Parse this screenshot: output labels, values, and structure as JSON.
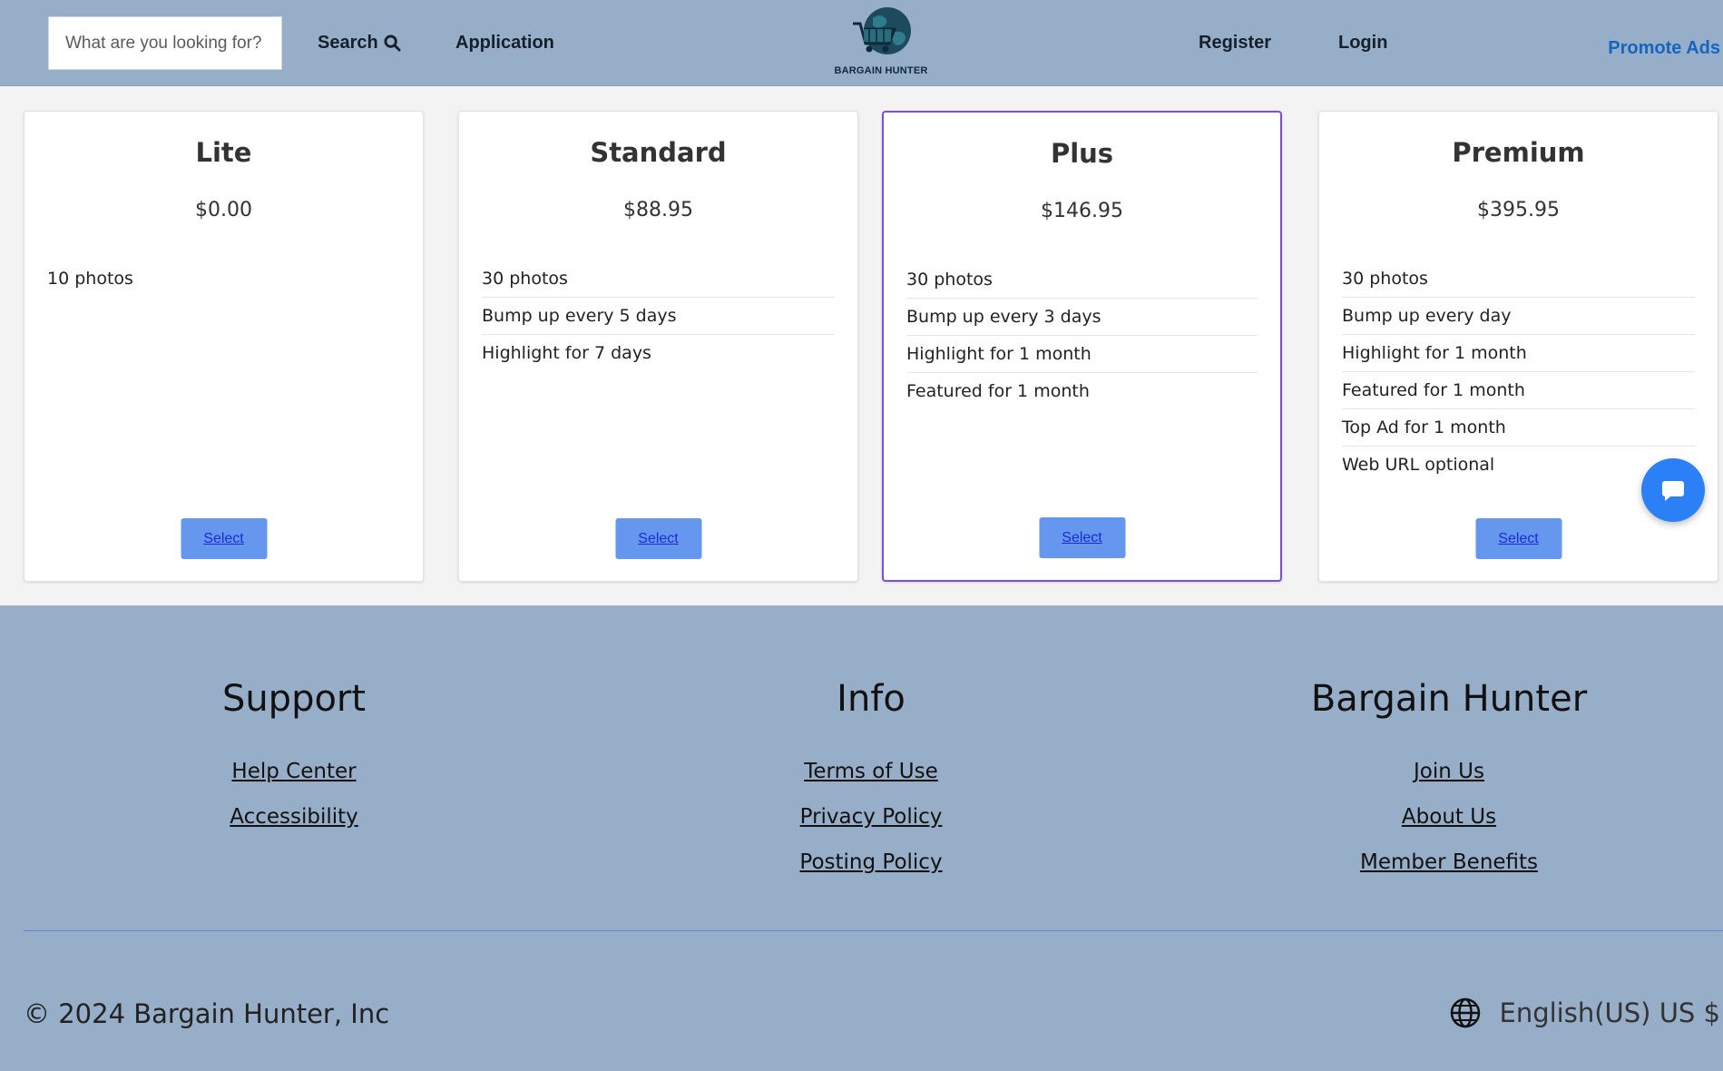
{
  "header": {
    "search_placeholder": "What are you looking for?",
    "search_label": "Search",
    "application_label": "Application",
    "logo_text": "BARGAIN HUNTER",
    "register_label": "Register",
    "login_label": "Login",
    "promote_label": "Promote Ads"
  },
  "plans": [
    {
      "name": "Lite",
      "price": "$0.00",
      "features": [
        "10 photos"
      ],
      "select_label": "Select"
    },
    {
      "name": "Standard",
      "price": "$88.95",
      "features": [
        "30 photos",
        "Bump up every 5 days",
        "Highlight for 7 days"
      ],
      "select_label": "Select"
    },
    {
      "name": "Plus",
      "price": "$146.95",
      "features": [
        "30 photos",
        "Bump up every 3 days",
        "Highlight for 1 month",
        "Featured for 1 month"
      ],
      "select_label": "Select"
    },
    {
      "name": "Premium",
      "price": "$395.95",
      "features": [
        "30 photos",
        "Bump up every day",
        "Highlight for 1 month",
        "Featured for 1 month",
        "Top Ad for 1 month",
        "Web URL optional"
      ],
      "select_label": "Select"
    }
  ],
  "footer": {
    "support": {
      "heading": "Support",
      "links": [
        "Help Center",
        "Accessibility"
      ]
    },
    "info": {
      "heading": "Info",
      "links": [
        "Terms of Use",
        "Privacy Policy",
        "Posting Policy"
      ]
    },
    "brand": {
      "heading": "Bargain Hunter",
      "links": [
        "Join Us",
        "About Us",
        "Member Benefits"
      ]
    },
    "copyright": "© 2024 Bargain Hunter, Inc",
    "locale": "English(US) US $"
  },
  "colors": {
    "header_bg": "#97aec8",
    "footer_bg": "#97aec8",
    "select_button": "#6697ee",
    "active_border": "#7b4fdc",
    "promote_link": "#1565c0",
    "chat_button": "#2b80f5"
  },
  "icons": [
    "search-icon",
    "logo-globe-cart-icon",
    "chat-icon",
    "globe-icon"
  ]
}
